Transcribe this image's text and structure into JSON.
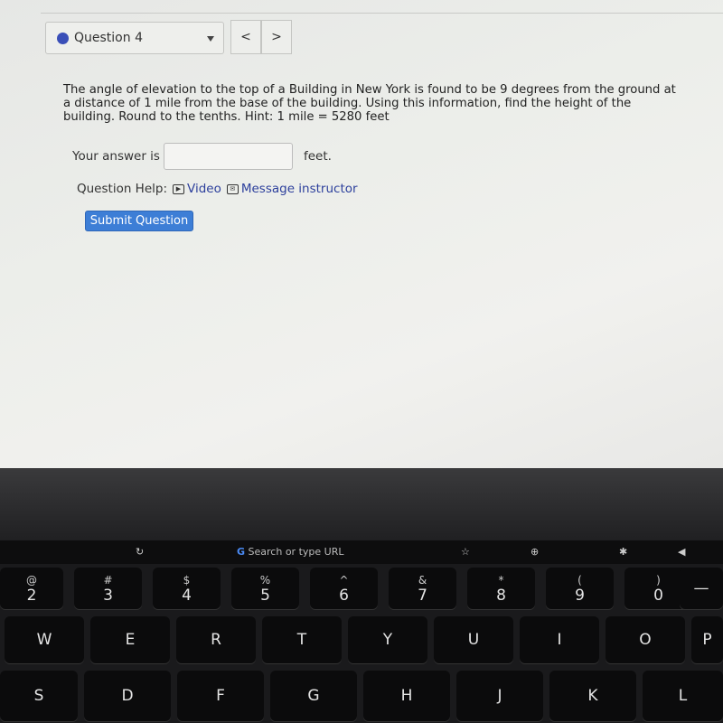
{
  "question_nav": {
    "selected": "Question 4",
    "prev": "<",
    "next": ">",
    "status_color": "#3a4fb8"
  },
  "question": {
    "text": "The angle of elevation to the top of a Building in New York is found to be 9 degrees from the ground at a distance of 1 mile from the base of the building. Using this information, find the height of the building. Round to the tenths. Hint: 1 mile = 5280 feet"
  },
  "answer": {
    "prefix": "Your answer is",
    "value": "",
    "suffix": "feet."
  },
  "help": {
    "label": "Question Help:",
    "video": "Video",
    "message": "Message instructor"
  },
  "submit": {
    "label": "Submit Question",
    "color": "#3d7ed6"
  },
  "touchbar": {
    "url_placeholder": "Search or type URL"
  },
  "keyboard": {
    "numbers": [
      {
        "top": "@",
        "main": "2"
      },
      {
        "top": "#",
        "main": "3"
      },
      {
        "top": "$",
        "main": "4"
      },
      {
        "top": "%",
        "main": "5"
      },
      {
        "top": "^",
        "main": "6"
      },
      {
        "top": "&",
        "main": "7"
      },
      {
        "top": "*",
        "main": "8"
      },
      {
        "top": "(",
        "main": "9"
      },
      {
        "top": ")",
        "main": "0"
      }
    ],
    "row2": [
      "W",
      "E",
      "R",
      "T",
      "Y",
      "U",
      "I",
      "O",
      "P"
    ],
    "row3": [
      "S",
      "D",
      "F",
      "G",
      "H",
      "J",
      "K",
      "L"
    ]
  }
}
